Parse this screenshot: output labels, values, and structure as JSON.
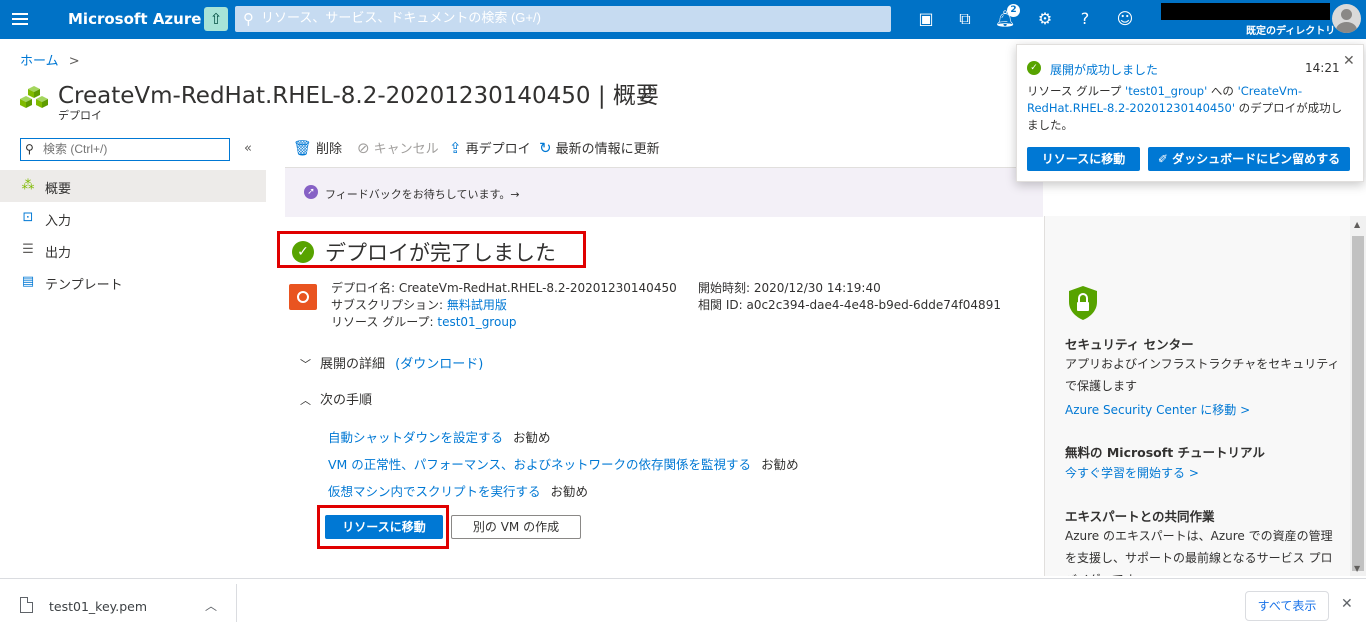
{
  "topbar": {
    "brand": "Microsoft Azure",
    "search_placeholder": "リソース、サービス、ドキュメントの検索 (G+/)",
    "notification_count": "2",
    "directory": "既定のディレクトリ"
  },
  "breadcrumb": {
    "home": "ホーム",
    "separator": ">"
  },
  "page": {
    "title": "CreateVm-RedHat.RHEL-8.2-20201230140450 | 概要",
    "subtitle": "デプロイ"
  },
  "sidebar": {
    "search_placeholder": "検索 (Ctrl+/)",
    "collapse": "«",
    "items": [
      {
        "label": "概要",
        "icon": "overview-icon"
      },
      {
        "label": "入力",
        "icon": "input-icon"
      },
      {
        "label": "出力",
        "icon": "output-icon"
      },
      {
        "label": "テンプレート",
        "icon": "template-icon"
      }
    ]
  },
  "commands": {
    "delete": "削除",
    "cancel": "キャンセル",
    "redeploy": "再デプロイ",
    "refresh": "最新の情報に更新"
  },
  "feedback": {
    "text": "フィードバックをお待ちしています。→"
  },
  "status": {
    "text": "デプロイが完了しました"
  },
  "deployment": {
    "name_label": "デプロイ名:",
    "name_value": "CreateVm-RedHat.RHEL-8.2-20201230140450",
    "subscription_label": "サブスクリプション:",
    "subscription_value": "無料試用版",
    "resource_group_label": "リソース グループ:",
    "resource_group_value": "test01_group",
    "start_label": "開始時刻:",
    "start_value": "2020/12/30 14:19:40",
    "correlation_label": "相関 ID:",
    "correlation_value": "a0c2c394-dae4-4e48-b9ed-6dde74f04891"
  },
  "details": {
    "label": "展開の詳細",
    "download": "(ダウンロード)"
  },
  "next_steps": {
    "label": "次の手順",
    "items": [
      {
        "link": "自動シャットダウンを設定する",
        "note": "お勧め"
      },
      {
        "link": "VM の正常性、パフォーマンス、およびネットワークの依存関係を監視する",
        "note": "お勧め"
      },
      {
        "link": "仮想マシン内でスクリプトを実行する",
        "note": "お勧め"
      }
    ]
  },
  "actions": {
    "go_to_resource": "リソースに移動",
    "create_another": "別の VM の作成"
  },
  "right_panel": {
    "security_title": "セキュリティ センター",
    "security_text": "アプリおよびインフラストラクチャをセキュリティで保護します",
    "security_link": "Azure Security Center に移動 >",
    "tutorial_title": "無料の Microsoft チュートリアル",
    "tutorial_link": "今すぐ学習を開始する >",
    "expert_title": "エキスパートとの共同作業",
    "expert_text": "Azure のエキスパートは、Azure での資産の管理を支援し、サポートの最前線となるサービス プロバイダーです。"
  },
  "toast": {
    "title": "展開が成功しました",
    "time": "14:21",
    "body_prefix": "リソース グループ ",
    "body_group": "'test01_group'",
    "body_mid": " への ",
    "body_deploy": "'CreateVm-RedHat.RHEL-8.2-20201230140450'",
    "body_suffix": " のデプロイが成功しました。",
    "btn_go": "リソースに移動",
    "btn_pin": "ダッシュボードにピン留めする"
  },
  "downloads": {
    "file": "test01_key.pem",
    "show_all": "すべて表示"
  },
  "colors": {
    "azure_blue": "#0072c6",
    "link_blue": "#0078d4",
    "success_green": "#57a300",
    "highlight_red": "#e00000",
    "ubuntu_orange": "#e95420"
  }
}
